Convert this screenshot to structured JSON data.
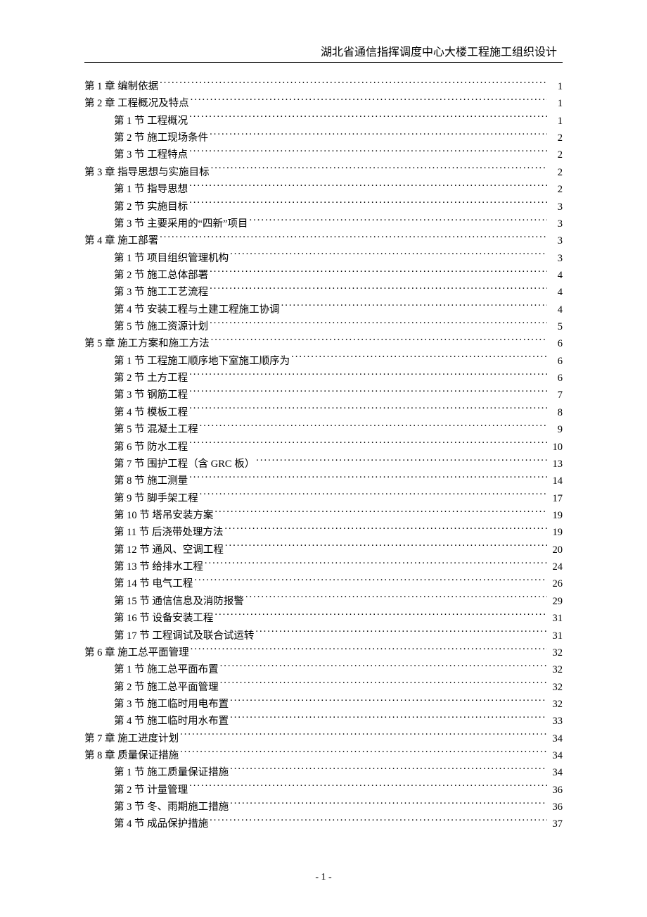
{
  "header": {
    "title": "湖北省通信指挥调度中心大楼工程施工组织设计"
  },
  "toc": [
    {
      "level": 1,
      "label": "第 1 章  编制依据",
      "page": "1"
    },
    {
      "level": 1,
      "label": "第 2 章  工程概况及特点",
      "page": "1"
    },
    {
      "level": 2,
      "label": "第 1 节  工程概况",
      "page": "1"
    },
    {
      "level": 2,
      "label": "第 2 节  施工现场条件",
      "page": "2"
    },
    {
      "level": 2,
      "label": "第 3 节  工程特点",
      "page": "2"
    },
    {
      "level": 1,
      "label": "第 3 章  指导思想与实施目标",
      "page": "2"
    },
    {
      "level": 2,
      "label": "第 1 节  指导思想",
      "page": "2"
    },
    {
      "level": 2,
      "label": "第 2 节  实施目标",
      "page": "3"
    },
    {
      "level": 2,
      "label": "第 3 节  主要采用的“四新”项目",
      "page": "3"
    },
    {
      "level": 1,
      "label": "第 4 章  施工部署",
      "page": "3"
    },
    {
      "level": 2,
      "label": "第 1 节  项目组织管理机构",
      "page": "3"
    },
    {
      "level": 2,
      "label": "第 2 节  施工总体部署",
      "page": "4"
    },
    {
      "level": 2,
      "label": "第 3 节  施工工艺流程",
      "page": "4"
    },
    {
      "level": 2,
      "label": "第 4 节  安装工程与土建工程施工协调",
      "page": "4"
    },
    {
      "level": 2,
      "label": "第 5 节  施工资源计划",
      "page": "5"
    },
    {
      "level": 1,
      "label": "第 5 章  施工方案和施工方法",
      "page": "6"
    },
    {
      "level": 2,
      "label": "第 1 节  工程施工顺序地下室施工顺序为",
      "page": "6"
    },
    {
      "level": 2,
      "label": "第 2 节  土方工程",
      "page": "6"
    },
    {
      "level": 2,
      "label": "第 3 节  钢筋工程",
      "page": "7"
    },
    {
      "level": 2,
      "label": "第 4 节  模板工程",
      "page": "8"
    },
    {
      "level": 2,
      "label": "第 5 节  混凝土工程",
      "page": "9"
    },
    {
      "level": 2,
      "label": "第 6 节  防水工程",
      "page": "10"
    },
    {
      "level": 2,
      "label": "第 7 节  围护工程（含 GRC 板）",
      "page": "13"
    },
    {
      "level": 2,
      "label": "第 8 节  施工测量",
      "page": "14"
    },
    {
      "level": 2,
      "label": "第 9 节  脚手架工程",
      "page": "17"
    },
    {
      "level": 2,
      "label": "第 10 节  塔吊安装方案",
      "page": "19"
    },
    {
      "level": 2,
      "label": "第 11 节  后浇带处理方法",
      "page": "19"
    },
    {
      "level": 2,
      "label": "第 12 节  通风、空调工程",
      "page": "20"
    },
    {
      "level": 2,
      "label": "第 13 节  给排水工程",
      "page": "24"
    },
    {
      "level": 2,
      "label": "第 14 节  电气工程",
      "page": "26"
    },
    {
      "level": 2,
      "label": "第 15 节  通信信息及消防报警",
      "page": "29"
    },
    {
      "level": 2,
      "label": "第 16 节  设备安装工程",
      "page": "31"
    },
    {
      "level": 2,
      "label": "第 17 节  工程调试及联合试运转",
      "page": "31"
    },
    {
      "level": 1,
      "label": "第 6 章  施工总平面管理",
      "page": "32"
    },
    {
      "level": 2,
      "label": "第 1 节  施工总平面布置",
      "page": "32"
    },
    {
      "level": 2,
      "label": "第 2 节  施工总平面管理",
      "page": "32"
    },
    {
      "level": 2,
      "label": "第 3 节  施工临时用电布置",
      "page": "32"
    },
    {
      "level": 2,
      "label": "第 4 节  施工临时用水布置",
      "page": "33"
    },
    {
      "level": 1,
      "label": "第 7 章  施工进度计划",
      "page": "34"
    },
    {
      "level": 1,
      "label": "第 8 章  质量保证措施",
      "page": "34"
    },
    {
      "level": 2,
      "label": "第 1 节  施工质量保证措施",
      "page": "34"
    },
    {
      "level": 2,
      "label": "第 2 节  计量管理",
      "page": "36"
    },
    {
      "level": 2,
      "label": "第 3 节  冬、雨期施工措施",
      "page": "36"
    },
    {
      "level": 2,
      "label": "第 4 节  成品保护措施",
      "page": "37"
    }
  ],
  "footer": {
    "page_number": "- 1 -"
  }
}
